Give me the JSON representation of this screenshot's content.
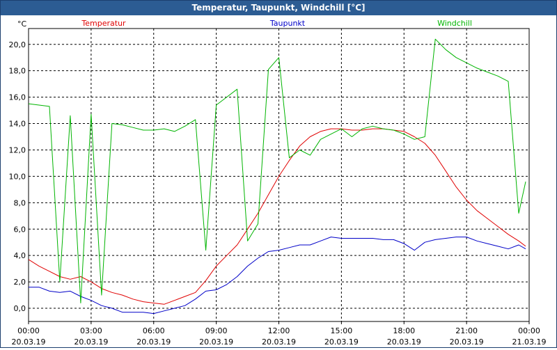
{
  "window": {
    "title": "Temperatur, Taupunkt, Windchill [°C]"
  },
  "chart_data": {
    "type": "line",
    "ylabel": "°C",
    "ylim": [
      -1,
      21.2
    ],
    "yticks": [
      0,
      2,
      4,
      6,
      8,
      10,
      12,
      14,
      16,
      18,
      20
    ],
    "ytick_labels": [
      "0,0",
      "2,0",
      "4,0",
      "6,0",
      "8,0",
      "10,0",
      "12,0",
      "14,0",
      "16,0",
      "18,0",
      "20,0"
    ],
    "x_domain": [
      "2019-03-20T00:00",
      "2019-03-21T00:00"
    ],
    "xticks": [
      {
        "time": "00:00",
        "date": "20.03.19"
      },
      {
        "time": "03:00",
        "date": "20.03.19"
      },
      {
        "time": "06:00",
        "date": "20.03.19"
      },
      {
        "time": "09:00",
        "date": "20.03.19"
      },
      {
        "time": "12:00",
        "date": "20.03.19"
      },
      {
        "time": "15:00",
        "date": "20.03.19"
      },
      {
        "time": "18:00",
        "date": "20.03.19"
      },
      {
        "time": "21:00",
        "date": "20.03.19"
      },
      {
        "time": "00:00",
        "date": "21.03.19"
      }
    ],
    "grid": true,
    "x": [
      "00:00",
      "00:30",
      "01:00",
      "01:30",
      "02:00",
      "02:30",
      "03:00",
      "03:30",
      "04:00",
      "04:30",
      "05:00",
      "05:30",
      "06:00",
      "06:30",
      "07:00",
      "07:30",
      "08:00",
      "08:30",
      "09:00",
      "09:30",
      "10:00",
      "10:30",
      "11:00",
      "11:30",
      "12:00",
      "12:30",
      "13:00",
      "13:30",
      "14:00",
      "14:30",
      "15:00",
      "15:30",
      "16:00",
      "16:30",
      "17:00",
      "17:30",
      "18:00",
      "18:30",
      "19:00",
      "19:30",
      "20:00",
      "20:30",
      "21:00",
      "21:30",
      "22:00",
      "22:30",
      "23:00",
      "23:30",
      "23:50"
    ],
    "series": [
      {
        "name": "Temperatur",
        "color": "#e00000",
        "values": [
          3.7,
          3.2,
          2.8,
          2.4,
          2.2,
          2.4,
          2.0,
          1.5,
          1.2,
          1.0,
          0.7,
          0.5,
          0.4,
          0.3,
          0.6,
          0.9,
          1.2,
          2.1,
          3.2,
          4.0,
          4.8,
          6.0,
          7.2,
          8.6,
          10.0,
          11.2,
          12.3,
          13.0,
          13.4,
          13.6,
          13.6,
          13.5,
          13.5,
          13.6,
          13.6,
          13.5,
          13.4,
          13.0,
          12.5,
          11.6,
          10.4,
          9.2,
          8.2,
          7.4,
          6.8,
          6.2,
          5.6,
          5.1,
          4.7
        ]
      },
      {
        "name": "Taupunkt",
        "color": "#0000c8",
        "values": [
          1.6,
          1.6,
          1.3,
          1.2,
          1.3,
          0.9,
          0.6,
          0.2,
          0.0,
          -0.3,
          -0.3,
          -0.3,
          -0.4,
          -0.2,
          0.0,
          0.2,
          0.7,
          1.3,
          1.4,
          1.8,
          2.4,
          3.2,
          3.8,
          4.3,
          4.4,
          4.6,
          4.8,
          4.8,
          5.1,
          5.4,
          5.3,
          5.3,
          5.3,
          5.3,
          5.2,
          5.2,
          4.9,
          4.4,
          5.0,
          5.2,
          5.3,
          5.4,
          5.4,
          5.1,
          4.9,
          4.7,
          4.5,
          4.8,
          4.5
        ]
      },
      {
        "name": "Windchill",
        "color": "#00b400",
        "values": [
          15.5,
          15.4,
          15.3,
          2.0,
          14.6,
          0.4,
          14.7,
          1.0,
          14.0,
          13.9,
          13.7,
          13.5,
          13.5,
          13.6,
          13.4,
          13.8,
          14.3,
          4.4,
          15.4,
          16.0,
          16.6,
          5.1,
          6.4,
          18.1,
          19.0,
          11.4,
          12.0,
          11.6,
          12.8,
          13.2,
          13.6,
          13.0,
          13.6,
          13.8,
          13.6,
          13.5,
          13.2,
          12.8,
          13.0,
          20.4,
          19.6,
          19.0,
          18.6,
          18.2,
          17.9,
          17.6,
          17.2,
          7.2,
          9.6
        ]
      }
    ]
  }
}
